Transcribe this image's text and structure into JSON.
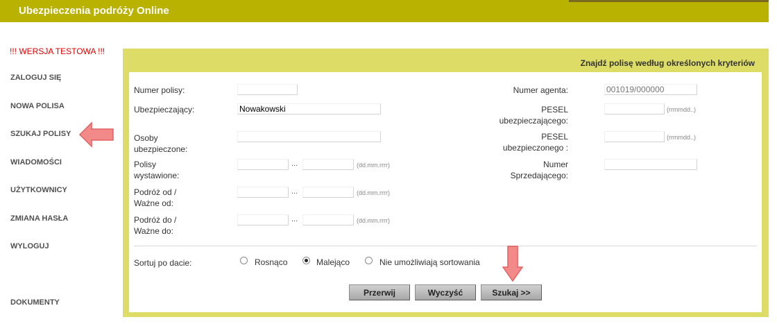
{
  "header": {
    "title": "Ubezpieczenia podróży Online"
  },
  "warning": "!!! WERSJA TESTOWA !!!",
  "nav": {
    "login": "ZALOGUJ SIĘ",
    "new_policy": "NOWA POLISA",
    "search": "SZUKAJ POLISY",
    "messages": "WIADOMOŚCI",
    "users": "UŻYTKOWNICY",
    "change_password": "ZMIANA HASŁA",
    "logout": "WYLOGUJ",
    "documents": "DOKUMENTY"
  },
  "panel": {
    "title": "Znajdź polisę według określonych kryteriów"
  },
  "form": {
    "policy_number": {
      "label": "Numer polisy:",
      "value": ""
    },
    "insurer": {
      "label": "Ubezpieczający:",
      "value": "Nowakowski"
    },
    "insured_label_1": "Osoby",
    "insured_label_2": "ubezpieczone:",
    "issued_label_1": "Polisy",
    "issued_label_2": "wystawione:",
    "travel_from_label_1": "Podróż od /",
    "travel_from_label_2": "Ważne od:",
    "travel_to_label_1": "Podróż do /",
    "travel_to_label_2": "Ważne do:",
    "date_hint": "(dd.mm.rrrr)",
    "ellipsis": "...",
    "agent": {
      "label": "Numer agenta:",
      "value": "001019/000000"
    },
    "pesel_insurer_label_1": "PESEL",
    "pesel_insurer_label_2": "ubezpieczającego:",
    "pesel_insured_label_1": "PESEL",
    "pesel_insured_label_2": "ubezpieczonego :",
    "pesel_hint": "(rrmmdd..)",
    "seller_label_1": "Numer",
    "seller_label_2": "Sprzedającego:"
  },
  "sort": {
    "label": "Sortuj po dacie:",
    "options": [
      "Rosnąco",
      "Malejąco",
      "Nie umożliwiają sortowania"
    ],
    "selected": "Malejąco"
  },
  "buttons": {
    "cancel": "Przerwij",
    "clear": "Wyczyść",
    "search": "Szukaj >>"
  },
  "colors": {
    "header_bg": "#b9b200",
    "panel_bg": "#dcdc66",
    "warning": "#e00000",
    "arrow": "#f28a8a"
  },
  "icons": [
    "left-arrow-icon",
    "down-arrow-icon"
  ]
}
